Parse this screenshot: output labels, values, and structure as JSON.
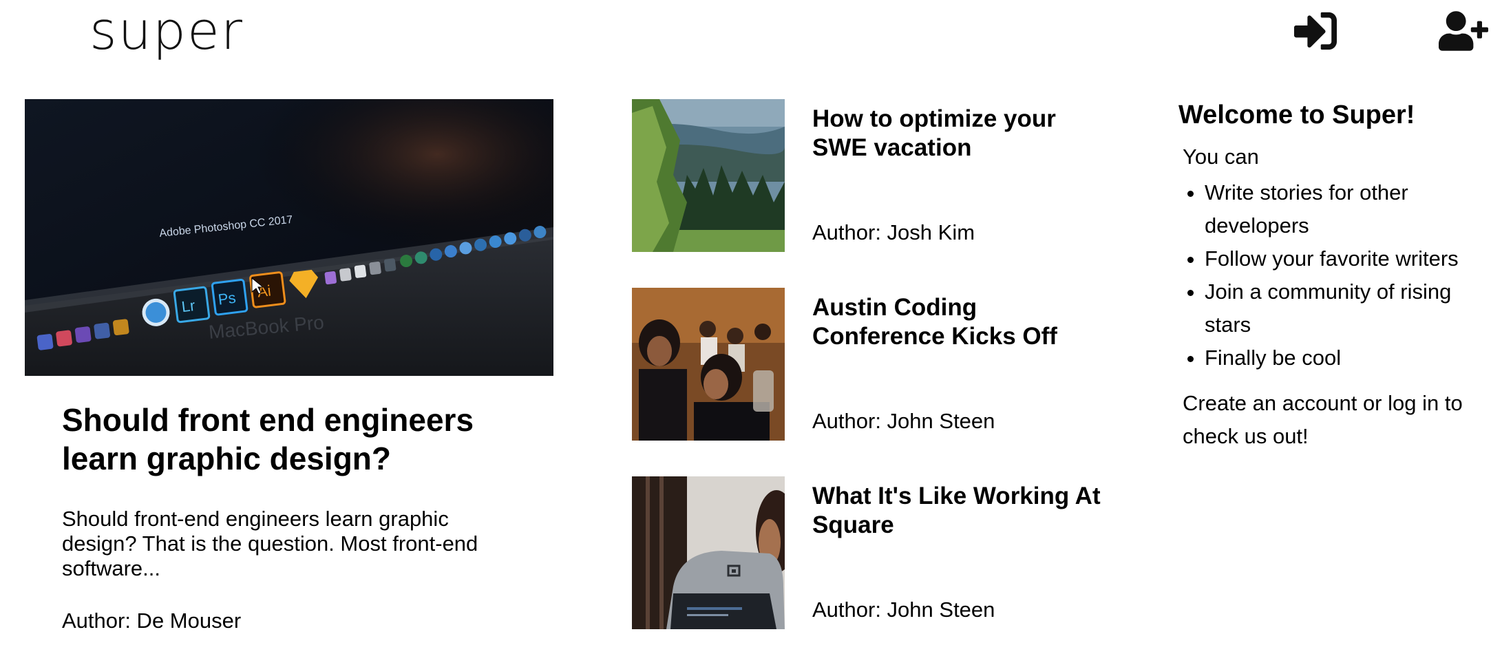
{
  "header": {
    "logo": "super",
    "login_icon": "sign-in-icon",
    "signup_icon": "user-plus-icon"
  },
  "featured": {
    "image_icon": "photoshop-dock-photo",
    "image_caption": "Adobe Photoshop CC 2017",
    "image_brand": "MacBook Pro",
    "title": "Should front end engineers learn graphic design?",
    "excerpt": "Should front-end engineers learn graphic design? That is the question. Most front-end software...",
    "author": "Author: De Mouser"
  },
  "stories": [
    {
      "image_icon": "forest-valley-photo",
      "title": "How to optimize your SWE vacation",
      "author": "Author: Josh Kim"
    },
    {
      "image_icon": "conference-audience-photo",
      "title": "Austin Coding Conference Kicks Off",
      "author": "Author: John Steen"
    },
    {
      "image_icon": "square-terminal-photo",
      "title": "What It's Like Working At Square",
      "author": "Author: John Steen"
    }
  ],
  "welcome": {
    "title": "Welcome to Super!",
    "lead": "You can",
    "items": [
      "Write stories for other developers",
      "Follow your favorite writers",
      "Join a community of rising stars",
      "Finally be cool"
    ],
    "cta": "Create an account or log in to check us out!"
  },
  "colors": {
    "text": "#000000",
    "background": "#ffffff"
  }
}
